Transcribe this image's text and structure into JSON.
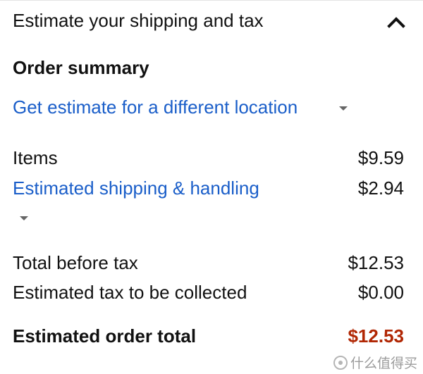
{
  "header": {
    "title": "Estimate your shipping and tax",
    "toggle_icon": "chevron-up-icon"
  },
  "summary": {
    "title": "Order summary",
    "location_link": "Get estimate for a different location",
    "items_label": "Items",
    "items_value": "$9.59",
    "shipping_label": "Estimated shipping & handling",
    "shipping_value": "$2.94",
    "before_tax_label": "Total before tax",
    "before_tax_value": "$12.53",
    "tax_label": "Estimated tax to be collected",
    "tax_value": "$0.00",
    "total_label": "Estimated order total",
    "total_value": "$12.53"
  },
  "colors": {
    "link": "#1a5ec9",
    "total": "#b12704",
    "text": "#111111"
  },
  "watermark": {
    "text": "什么值得买"
  }
}
